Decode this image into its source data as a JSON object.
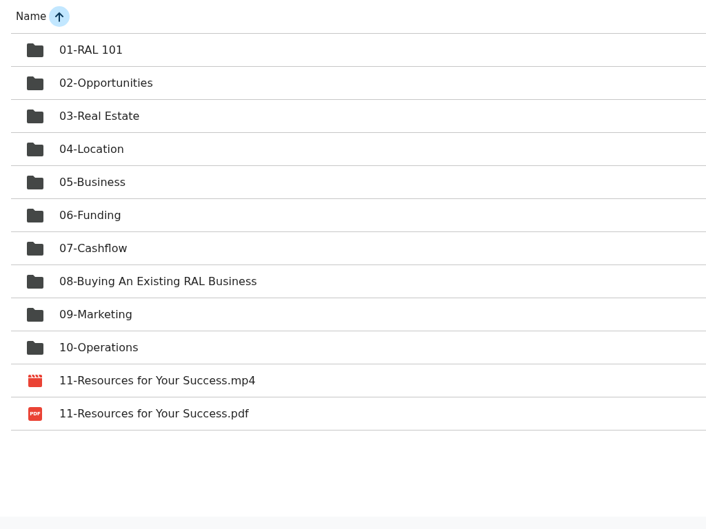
{
  "header": {
    "label": "Name",
    "sort_ascending": true
  },
  "files": [
    {
      "name": "01-RAL 101",
      "kind": "folder"
    },
    {
      "name": "02-Opportunities",
      "kind": "folder"
    },
    {
      "name": "03-Real Estate",
      "kind": "folder"
    },
    {
      "name": "04-Location",
      "kind": "folder"
    },
    {
      "name": "05-Business",
      "kind": "folder"
    },
    {
      "name": "06-Funding",
      "kind": "folder"
    },
    {
      "name": "07-Cashflow",
      "kind": "folder"
    },
    {
      "name": "08-Buying An Existing RAL Business",
      "kind": "folder"
    },
    {
      "name": "09-Marketing",
      "kind": "folder"
    },
    {
      "name": "10-Operations",
      "kind": "folder"
    },
    {
      "name": "11-Resources for Your Success.mp4",
      "kind": "video"
    },
    {
      "name": "11-Resources for Your Success.pdf",
      "kind": "pdf",
      "icon_text": "PDF"
    }
  ]
}
